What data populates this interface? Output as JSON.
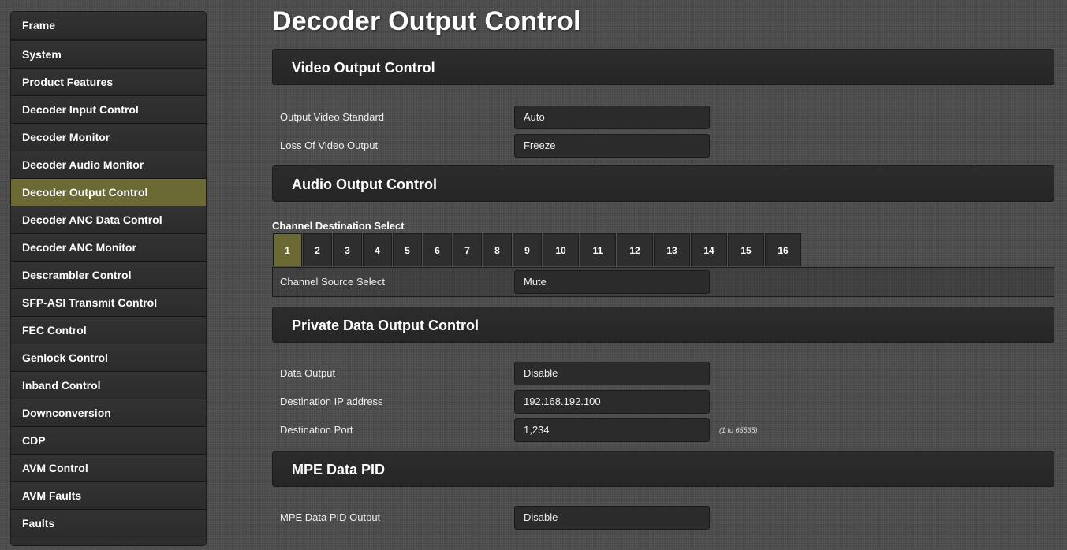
{
  "sidebar": {
    "items": [
      {
        "label": "Frame"
      },
      {
        "label": "System"
      },
      {
        "label": "Product Features"
      },
      {
        "label": "Decoder Input Control"
      },
      {
        "label": "Decoder Monitor"
      },
      {
        "label": "Decoder Audio Monitor"
      },
      {
        "label": "Decoder Output Control"
      },
      {
        "label": "Decoder ANC Data Control"
      },
      {
        "label": "Decoder ANC Monitor"
      },
      {
        "label": "Descrambler Control"
      },
      {
        "label": "SFP-ASI Transmit Control"
      },
      {
        "label": "FEC Control"
      },
      {
        "label": "Genlock Control"
      },
      {
        "label": "Inband Control"
      },
      {
        "label": "Downconversion"
      },
      {
        "label": "CDP"
      },
      {
        "label": "AVM Control"
      },
      {
        "label": "AVM Faults"
      },
      {
        "label": "Faults"
      }
    ],
    "active_index": 6
  },
  "page_title": "Decoder Output Control",
  "video_output": {
    "header": "Video Output Control",
    "output_video_standard": {
      "label": "Output Video Standard",
      "value": "Auto"
    },
    "loss_of_video_output": {
      "label": "Loss Of Video Output",
      "value": "Freeze"
    }
  },
  "audio_output": {
    "header": "Audio Output Control",
    "channel_destination_title": "Channel Destination Select",
    "channels": [
      "1",
      "2",
      "3",
      "4",
      "5",
      "6",
      "7",
      "8",
      "9",
      "10",
      "11",
      "12",
      "13",
      "14",
      "15",
      "16"
    ],
    "selected_channel": "1",
    "channel_source": {
      "label": "Channel Source Select",
      "value": "Mute"
    }
  },
  "private_data": {
    "header": "Private Data Output Control",
    "data_output": {
      "label": "Data Output",
      "value": "Disable"
    },
    "destination_ip": {
      "label": "Destination IP address",
      "value": "192.168.192.100"
    },
    "destination_port": {
      "label": "Destination Port",
      "value": "1,234",
      "hint": "(1 to 65535)"
    }
  },
  "mpe": {
    "header": "MPE Data PID",
    "mpe_output": {
      "label": "MPE Data PID Output",
      "value": "Disable"
    }
  },
  "colors": {
    "active_highlight": "#6b6a35",
    "panel": "#2c2c2c",
    "background": "#4a4a4a"
  }
}
